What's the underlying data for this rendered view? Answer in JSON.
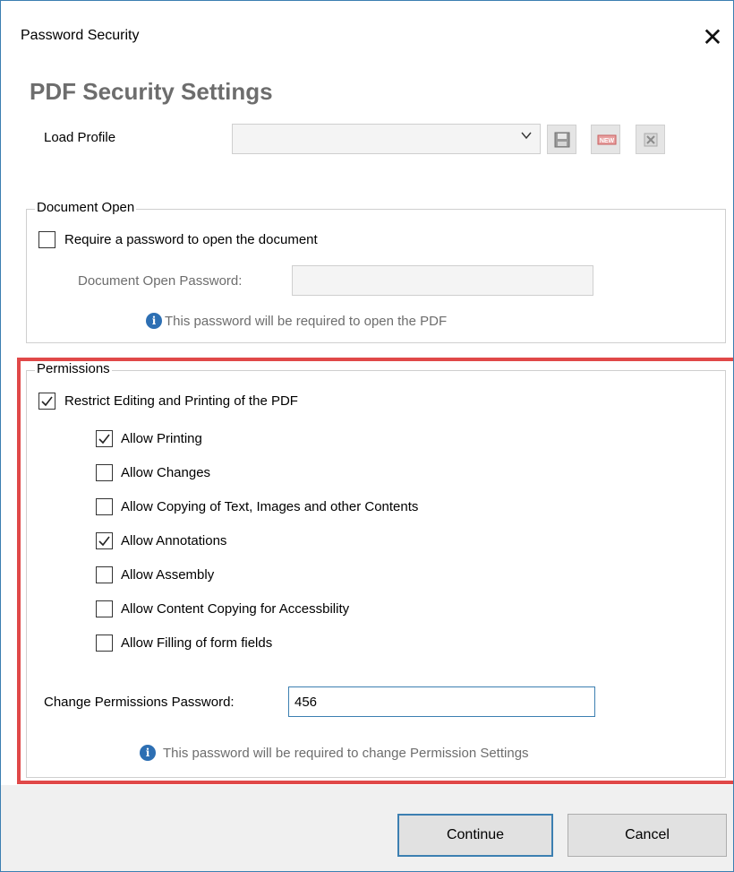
{
  "window": {
    "title": "Password Security",
    "close_glyph": "✕"
  },
  "heading": "PDF Security Settings",
  "load_profile": {
    "label": "Load Profile",
    "selected_value": "",
    "buttons": [
      "save-icon",
      "new-icon",
      "delete-icon"
    ],
    "new_badge_text": "NEW"
  },
  "document_open": {
    "group_title": "Document Open",
    "require_label": "Require a password to open the document",
    "require_checked": false,
    "password_label": "Document Open Password:",
    "password_value": "",
    "info_text": "This password will be required to open the PDF"
  },
  "permissions": {
    "group_title": "Permissions",
    "restrict_label": "Restrict Editing and Printing of the PDF",
    "restrict_checked": true,
    "options": [
      {
        "label": "Allow Printing",
        "checked": true
      },
      {
        "label": "Allow Changes",
        "checked": false
      },
      {
        "label": "Allow Copying of Text, Images and other Contents",
        "checked": false
      },
      {
        "label": "Allow Annotations",
        "checked": true
      },
      {
        "label": "Allow Assembly",
        "checked": false
      },
      {
        "label": "Allow Content Copying for Accessbility",
        "checked": false
      },
      {
        "label": "Allow Filling of form fields",
        "checked": false
      }
    ],
    "password_label": "Change Permissions Password:",
    "password_value": "456",
    "info_text": "This password will be required to change Permission Settings"
  },
  "footer": {
    "continue_label": "Continue",
    "cancel_label": "Cancel"
  },
  "colors": {
    "accent": "#3c7fb1",
    "highlight": "#e04848",
    "heading": "#6d6d6d",
    "info": "#2d6fb3"
  }
}
